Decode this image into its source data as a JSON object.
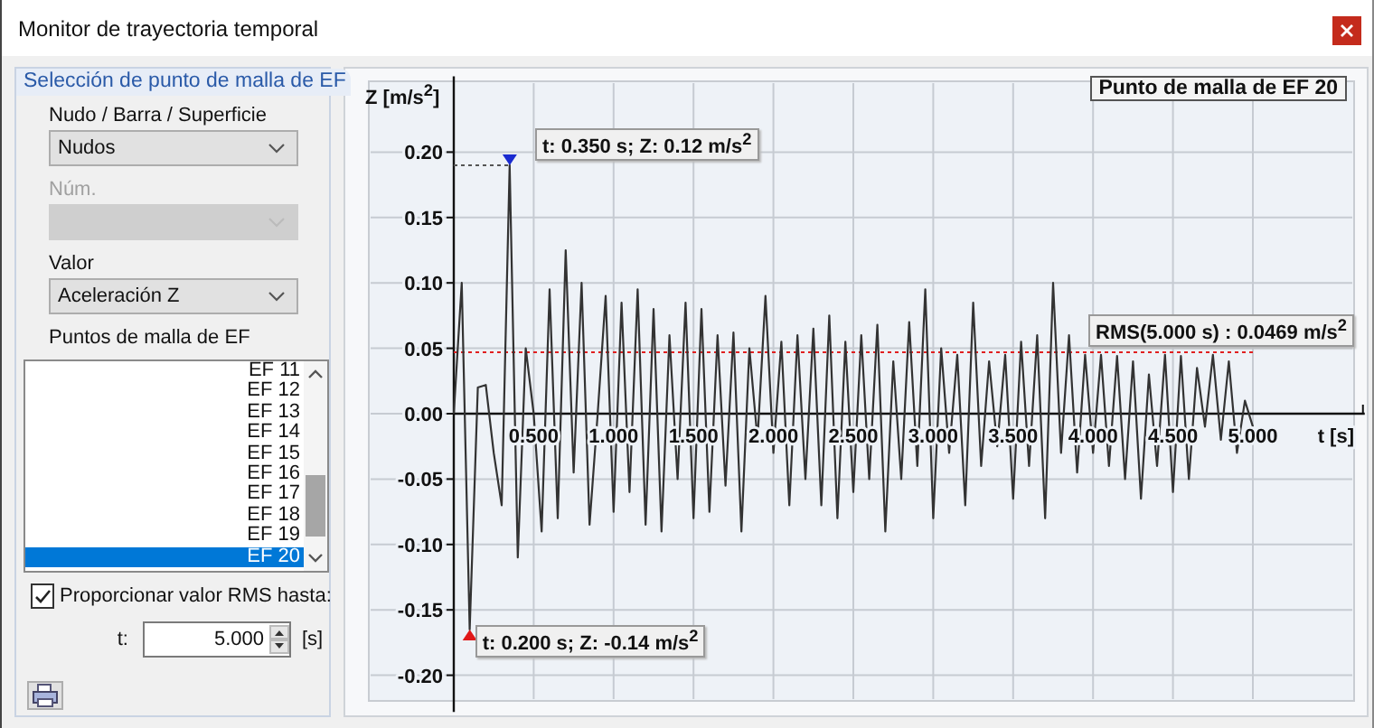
{
  "window": {
    "title": "Monitor de trayectoria temporal"
  },
  "selection": {
    "title": "Selección de punto de malla de EF",
    "fields": [
      {
        "label": "Nudo / Barra / Superficie",
        "value": "Nudos",
        "disabled": false
      },
      {
        "label": "Núm.",
        "disabled": true
      },
      {
        "label": "Valor",
        "value": "Aceleración Z",
        "disabled": false
      }
    ],
    "list_label": "Puntos de malla de EF",
    "list_items": [
      {
        "label": "EF 11",
        "selected": false
      },
      {
        "label": "EF 12",
        "selected": false
      },
      {
        "label": "EF 13",
        "selected": false
      },
      {
        "label": "EF 14",
        "selected": false
      },
      {
        "label": "EF 15",
        "selected": false
      },
      {
        "label": "EF 16",
        "selected": false
      },
      {
        "label": "EF 17",
        "selected": false
      },
      {
        "label": "EF 18",
        "selected": false
      },
      {
        "label": "EF 19",
        "selected": false
      },
      {
        "label": "EF 20",
        "selected": true
      }
    ],
    "rms": {
      "label": "Proporcionar valor RMS hasta:",
      "checked": true,
      "t_label": "t:",
      "t_value": "5.000",
      "unit": "[s]"
    }
  },
  "chart": {
    "chart_data": {
      "type": "line",
      "title": "Punto de malla de EF 20",
      "xlabel": "t [s]",
      "ylabel": "Z [m/s$^{2}$]",
      "x": [
        0,
        0.05,
        0.1,
        0.15,
        0.2,
        0.25,
        0.3,
        0.35,
        0.4,
        0.45,
        0.5,
        0.55,
        0.6,
        0.65,
        0.7,
        0.75,
        0.8,
        0.85,
        0.9,
        0.95,
        1,
        1.05,
        1.1,
        1.15,
        1.2,
        1.25,
        1.3,
        1.35,
        1.4,
        1.45,
        1.5,
        1.55,
        1.6,
        1.65,
        1.7,
        1.75,
        1.8,
        1.85,
        1.9,
        1.95,
        2,
        2.05,
        2.1,
        2.15,
        2.2,
        2.25,
        2.3,
        2.35,
        2.4,
        2.45,
        2.5,
        2.55,
        2.6,
        2.65,
        2.7,
        2.75,
        2.8,
        2.85,
        2.9,
        2.95,
        3,
        3.05,
        3.1,
        3.15,
        3.2,
        3.25,
        3.3,
        3.35,
        3.4,
        3.45,
        3.5,
        3.55,
        3.6,
        3.65,
        3.7,
        3.75,
        3.8,
        3.85,
        3.9,
        3.95,
        4,
        4.05,
        4.1,
        4.15,
        4.2,
        4.25,
        4.3,
        4.35,
        4.4,
        4.45,
        4.5,
        4.55,
        4.6,
        4.65,
        4.7,
        4.75,
        4.8,
        4.85,
        4.9,
        4.95,
        5
      ],
      "series": [
        {
          "color": "#333333",
          "values": [
            0.0,
            0.1,
            -0.165,
            0.02,
            0.022,
            -0.03,
            -0.07,
            0.19,
            -0.11,
            0.05,
            0.0,
            -0.09,
            0.095,
            -0.08,
            0.125,
            -0.045,
            0.1,
            -0.085,
            0.0,
            0.09,
            -0.075,
            0.085,
            -0.06,
            0.095,
            -0.085,
            0.08,
            -0.09,
            0.06,
            -0.05,
            0.085,
            -0.08,
            0.08,
            -0.075,
            0.06,
            -0.055,
            0.062,
            -0.09,
            0.05,
            -0.02,
            0.09,
            -0.03,
            0.055,
            -0.07,
            0.06,
            -0.05,
            0.065,
            -0.07,
            0.075,
            -0.08,
            0.055,
            -0.06,
            0.06,
            -0.05,
            0.068,
            -0.09,
            0.04,
            -0.05,
            0.07,
            -0.04,
            0.095,
            -0.08,
            0.05,
            -0.03,
            0.045,
            -0.07,
            0.085,
            -0.04,
            0.04,
            -0.025,
            0.045,
            -0.065,
            0.055,
            -0.04,
            0.06,
            -0.08,
            0.1,
            -0.03,
            0.06,
            -0.045,
            0.045,
            -0.03,
            0.045,
            -0.04,
            0.044,
            -0.05,
            0.04,
            -0.065,
            0.03,
            -0.04,
            0.045,
            -0.06,
            0.044,
            -0.05,
            0.035,
            -0.01,
            0.045,
            -0.02,
            0.04,
            -0.03,
            0.01,
            -0.01
          ]
        }
      ],
      "xlim": [
        0,
        5.7
      ],
      "ylim": [
        -0.228,
        0.258
      ],
      "grid": true,
      "xticks": [
        {
          "value": 0.5,
          "label": "0.500"
        },
        {
          "value": 1,
          "label": "1.000"
        },
        {
          "value": 1.5,
          "label": "1.500"
        },
        {
          "value": 2,
          "label": "2.000"
        },
        {
          "value": 2.5,
          "label": "2.500"
        },
        {
          "value": 3,
          "label": "3.000"
        },
        {
          "value": 3.5,
          "label": "3.500"
        },
        {
          "value": 4,
          "label": "4.000"
        },
        {
          "value": 4.5,
          "label": "4.500"
        },
        {
          "value": 5,
          "label": "5.000"
        }
      ],
      "yticks": [
        {
          "value": 0.2,
          "label": "0.20"
        },
        {
          "value": 0.15,
          "label": "0.15"
        },
        {
          "value": 0.1,
          "label": "0.10"
        },
        {
          "value": 0.05,
          "label": "0.05"
        },
        {
          "value": 0,
          "label": "0.00"
        },
        {
          "value": -0.05,
          "label": "-0.05"
        },
        {
          "value": -0.1,
          "label": "-0.10"
        },
        {
          "value": -0.15,
          "label": "-0.15"
        },
        {
          "value": -0.2,
          "label": "-0.20"
        }
      ],
      "annotations": [
        {
          "text": "t: 0.350 s; Z: 0.12 m/s$^{2}$",
          "x": 0.35,
          "y": 0.19
        },
        {
          "text": "t: 0.200 s; Z: -0.14 m/s$^{2}$",
          "x": 0.1,
          "y": -0.165
        }
      ],
      "ref_lines": [
        {
          "axis": "y",
          "value": 0.0469,
          "label": "RMS(5.000 s) : 0.0469 m/s$^{2}$",
          "color": "#e02020"
        }
      ]
    }
  }
}
